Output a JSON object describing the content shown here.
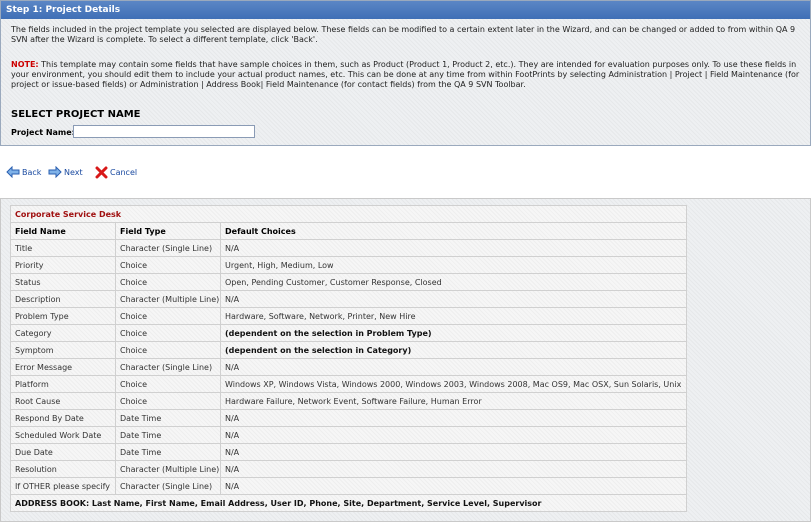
{
  "header": {
    "title": "Step 1: Project Details"
  },
  "intro": "The fields included in the project template you selected are displayed below. These fields can be modified to a certain extent later in the Wizard, and can be changed or added to from within QA 9 SVN after the Wizard is complete. To select a different template, click 'Back'.",
  "note": {
    "label": "NOTE:",
    "text": " This template may contain some fields that have sample choices in them, such as Product (Product 1, Product 2, etc.). They are intended for evaluation purposes only. To use these fields in your environment, you should edit them to include your actual product names, etc. This can be done at any time from within FootPrints by selecting Administration | Project | Field Maintenance (for project or issue-based fields) or Administration | Address Book| Field Maintenance (for contact fields) from the QA 9 SVN Toolbar."
  },
  "project_section": {
    "title": "SELECT PROJECT NAME",
    "label": "Project Name:",
    "value": ""
  },
  "nav": {
    "back": "Back",
    "next": "Next",
    "cancel": "Cancel"
  },
  "table": {
    "title": "Corporate Service Desk",
    "headers": [
      "Field Name",
      "Field Type",
      "Default Choices"
    ],
    "rows": [
      {
        "name": "Title",
        "type": "Character (Single Line)",
        "choices": "N/A"
      },
      {
        "name": "Priority",
        "type": "Choice",
        "choices": "Urgent, High, Medium, Low"
      },
      {
        "name": "Status",
        "type": "Choice",
        "choices": "Open, Pending Customer, Customer Response, Closed"
      },
      {
        "name": "Description",
        "type": "Character (Multiple Line)",
        "choices": "N/A"
      },
      {
        "name": "Problem Type",
        "type": "Choice",
        "choices": "Hardware, Software, Network, Printer, New Hire"
      },
      {
        "name": "Category",
        "type": "Choice",
        "choices": "(dependent on the selection in Problem Type)"
      },
      {
        "name": "Symptom",
        "type": "Choice",
        "choices": "(dependent on the selection in Category)"
      },
      {
        "name": "Error Message",
        "type": "Character (Single Line)",
        "choices": "N/A"
      },
      {
        "name": "Platform",
        "type": "Choice",
        "choices": "Windows XP, Windows Vista, Windows 2000, Windows 2003, Windows 2008, Mac OS9, Mac OSX, Sun Solaris, Unix"
      },
      {
        "name": "Root Cause",
        "type": "Choice",
        "choices": "Hardware Failure, Network Event, Software Failure, Human Error"
      },
      {
        "name": "Respond By Date",
        "type": "Date Time",
        "choices": "N/A"
      },
      {
        "name": "Scheduled Work Date",
        "type": "Date Time",
        "choices": "N/A"
      },
      {
        "name": "Due Date",
        "type": "Date Time",
        "choices": "N/A"
      },
      {
        "name": "Resolution",
        "type": "Character (Multiple Line)",
        "choices": "N/A"
      },
      {
        "name": "If OTHER please specify",
        "type": "Character (Single Line)",
        "choices": "N/A"
      }
    ],
    "address_book": "ADDRESS BOOK: Last Name, First Name, Email Address, User ID, Phone, Site, Department, Service Level, Supervisor"
  },
  "colors": {
    "header_blue": "#4a78bd",
    "note_red": "#cc0000",
    "table_title_red": "#a01010",
    "link_blue": "#1a4aa0"
  },
  "icons": {
    "back": "left-arrow-icon",
    "next": "right-arrow-icon",
    "cancel": "red-x-icon"
  }
}
